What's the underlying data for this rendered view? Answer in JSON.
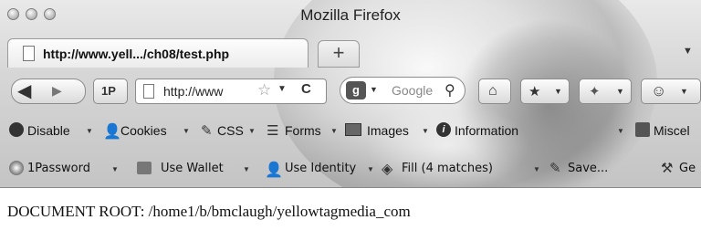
{
  "window": {
    "title": "Mozilla Firefox"
  },
  "tabs": [
    {
      "label": "http://www.yell.../ch08/test.php"
    }
  ],
  "new_tab": "+",
  "navbar": {
    "onepassword_label": "1P",
    "url_value": "http://www",
    "search_placeholder": "Google"
  },
  "webdev_toolbar": [
    {
      "label": "Disable"
    },
    {
      "label": "Cookies"
    },
    {
      "label": "CSS"
    },
    {
      "label": "Forms"
    },
    {
      "label": "Images"
    },
    {
      "label": "Information"
    },
    {
      "label": "Miscel"
    }
  ],
  "password_toolbar": [
    {
      "label": "1Password"
    },
    {
      "label": "Use Wallet"
    },
    {
      "label": "Use Identity"
    },
    {
      "label": "Fill (4 matches)"
    },
    {
      "label": "Save..."
    },
    {
      "label": "Ge"
    }
  ],
  "page": {
    "content": "DOCUMENT ROOT: /home1/b/bmclaugh/yellowtagmedia_com"
  }
}
